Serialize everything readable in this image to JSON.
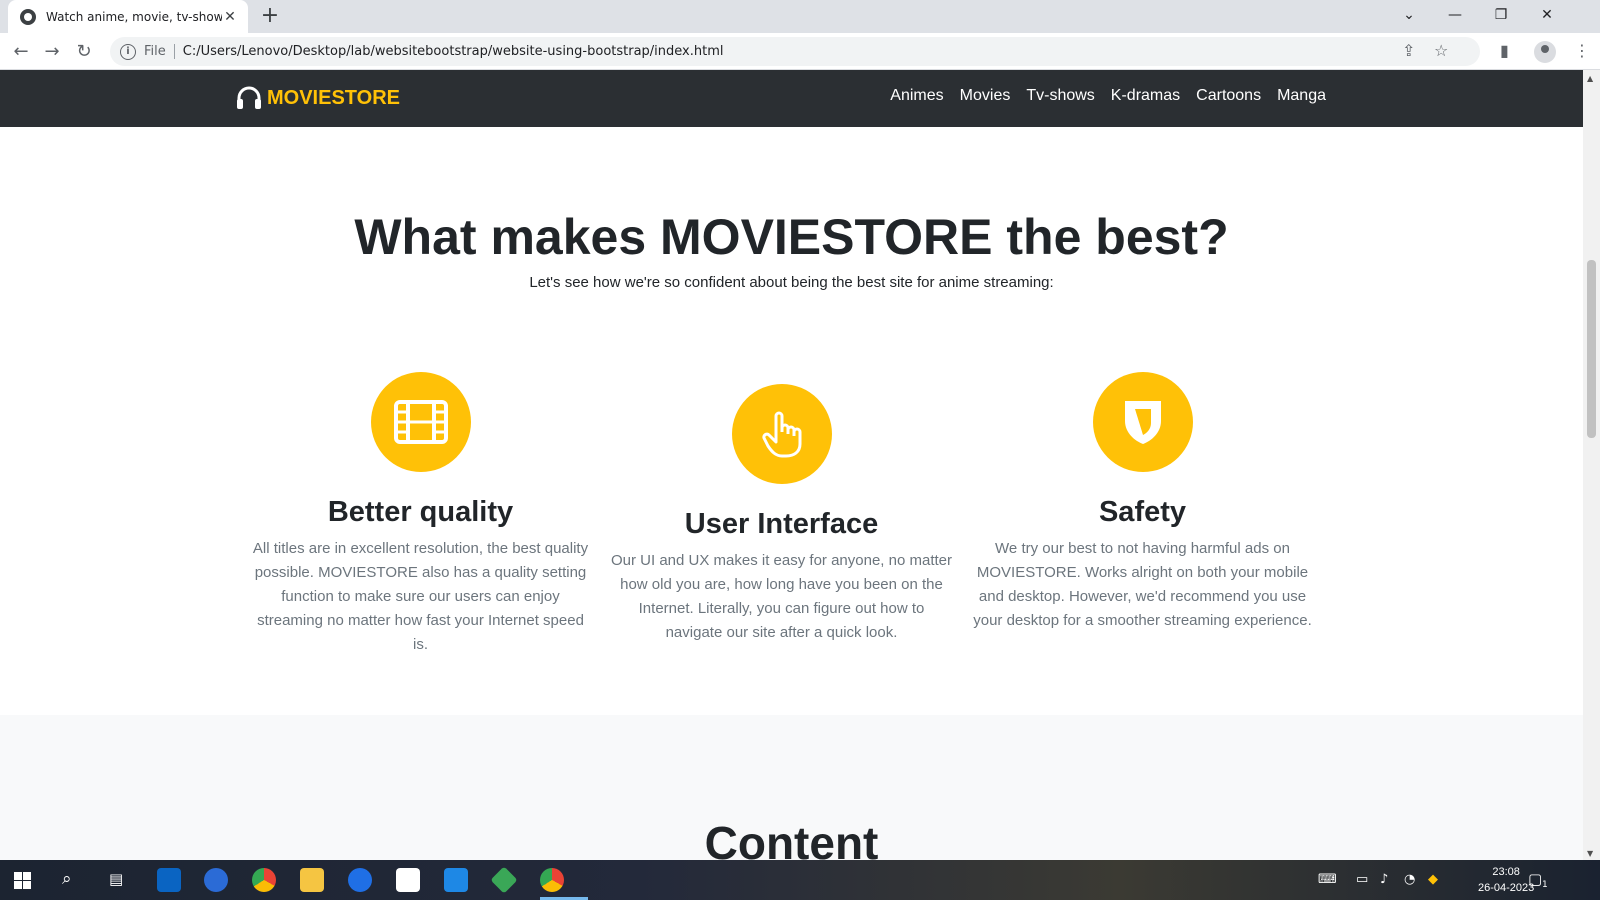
{
  "browser": {
    "tab_title": "Watch anime, movie, tv-shows",
    "close_tab": "✕",
    "new_tab": "+",
    "file_label": "File",
    "url": "C:/Users/Lenovo/Desktop/lab/websitebootstrap/website-using-bootstrap/index.html"
  },
  "site": {
    "brand": "MOVIESTORE",
    "nav": [
      "Animes",
      "Movies",
      "Tv-shows",
      "K-dramas",
      "Cartoons",
      "Manga"
    ],
    "heading": "What makes MOVIESTORE the best?",
    "subheading": "Let's see how we're so confident about being the best site for anime streaming:",
    "features": [
      {
        "icon": "film-icon",
        "title": "Better quality",
        "text": "All titles are in excellent resolution, the best quality possible. MOVIESTORE also has a quality setting function to make sure our users can enjoy streaming no matter how fast your Internet speed is."
      },
      {
        "icon": "pointing-hand-icon",
        "title": "User Interface",
        "text": "Our UI and UX makes it easy for anyone, no matter how old you are, how long have you been on the Internet. Literally, you can figure out how to navigate our site after a quick look."
      },
      {
        "icon": "shield-icon",
        "title": "Safety",
        "text": "We try our best to not having harmful ads on MOVIESTORE. Works alright on both your mobile and desktop. However, we'd recommend you use your desktop for a smoother streaming experience."
      }
    ],
    "next_section_title": "Content",
    "accent_color": "#ffc107",
    "navbar_color": "#2b2f33"
  },
  "taskbar": {
    "time": "23:08",
    "date": "26-04-2023",
    "notification_count": "1"
  }
}
